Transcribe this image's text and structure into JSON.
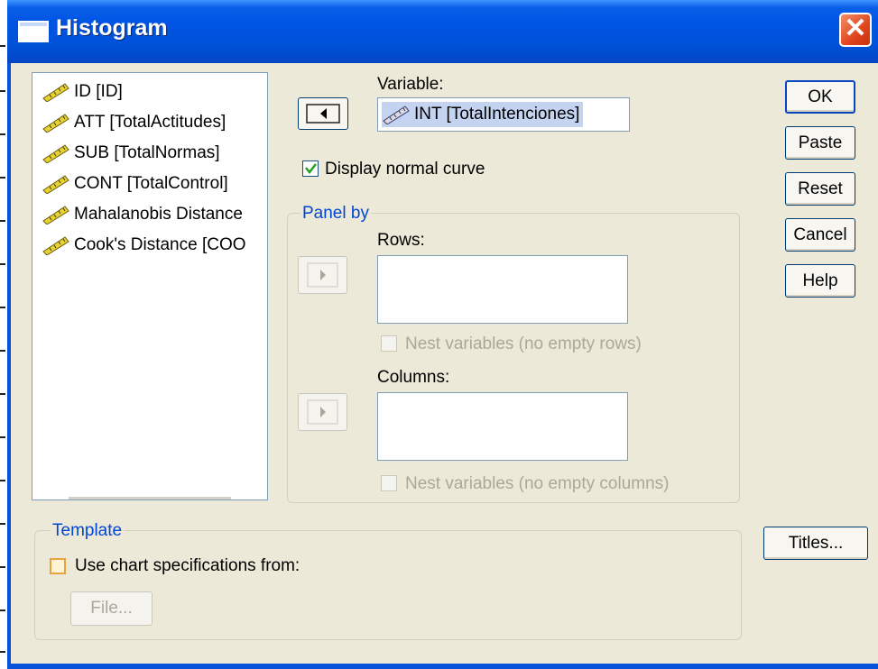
{
  "window": {
    "title": "Histogram"
  },
  "variables_list": [
    "ID [ID]",
    "ATT [TotalActitudes]",
    "SUB [TotalNormas]",
    "CONT [TotalControl]",
    "Mahalanobis Distance",
    "Cook's Distance [COO"
  ],
  "variable": {
    "label": "Variable:",
    "value": "INT [TotalIntenciones]"
  },
  "display_normal_curve": {
    "label": "Display normal curve",
    "checked": true
  },
  "panel_by": {
    "legend": "Panel by",
    "rows_label": "Rows:",
    "nest_rows_label": "Nest variables (no empty rows)",
    "columns_label": "Columns:",
    "nest_columns_label": "Nest variables (no empty columns)"
  },
  "template": {
    "legend": "Template",
    "use_spec_label": "Use chart specifications from:",
    "file_button": "File..."
  },
  "buttons": {
    "ok": "OK",
    "paste": "Paste",
    "reset": "Reset",
    "cancel": "Cancel",
    "help": "Help",
    "titles": "Titles..."
  },
  "colors": {
    "titlebar": "#0054e3",
    "accent_text": "#0046d5",
    "dialog_bg": "#ece9d8"
  },
  "icons": {
    "variable": "scale-ruler-icon",
    "close": "close-icon"
  }
}
